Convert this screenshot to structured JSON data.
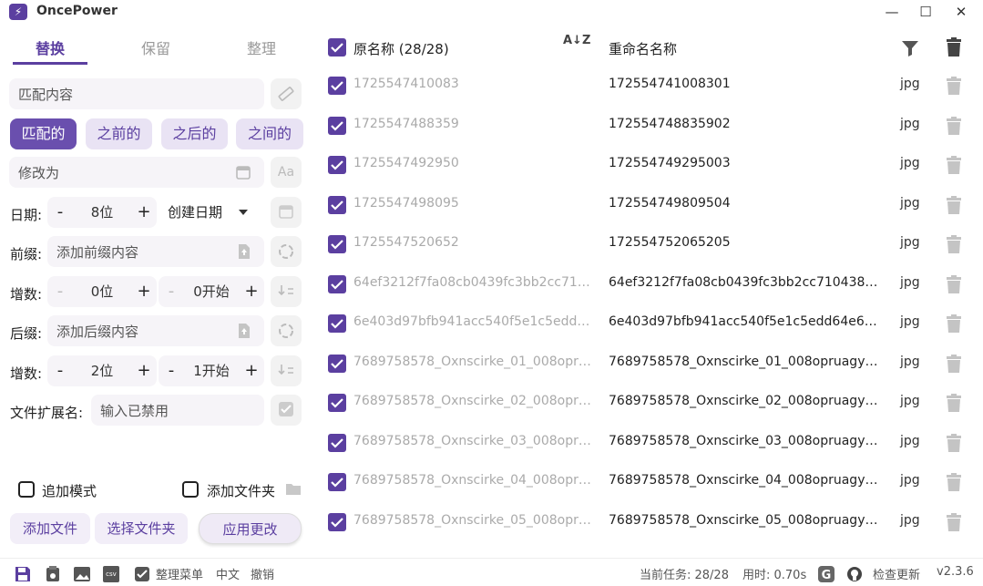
{
  "app": {
    "title": "OncePower",
    "logo_glyph": "⚡"
  },
  "window_controls": {
    "minimize": "—",
    "maximize": "☐",
    "close": "✕"
  },
  "tabs": [
    {
      "label": "替换",
      "active": true
    },
    {
      "label": "保留",
      "active": false
    },
    {
      "label": "整理",
      "active": false
    }
  ],
  "match": {
    "placeholder": "匹配内容"
  },
  "modes": [
    {
      "label": "匹配的",
      "active": true
    },
    {
      "label": "之前的",
      "active": false
    },
    {
      "label": "之后的",
      "active": false
    },
    {
      "label": "之间的",
      "active": false
    }
  ],
  "replace": {
    "placeholder": "修改为",
    "side_label": "Aa"
  },
  "date_row": {
    "label": "日期:",
    "minus": "-",
    "value": "8位",
    "plus": "+",
    "select": "创建日期"
  },
  "prefix_row": {
    "label": "前缀:",
    "placeholder": "添加前缀内容"
  },
  "inc1": {
    "label": "增数:",
    "digits": "0位",
    "start": "0开始",
    "minus": "-",
    "plus": "+"
  },
  "suffix_row": {
    "label": "后缀:",
    "placeholder": "添加后缀内容"
  },
  "inc2": {
    "label": "增数:",
    "digits": "2位",
    "start": "1开始",
    "minus": "-",
    "plus": "+"
  },
  "ext_row": {
    "label": "文件扩展名:",
    "placeholder": "输入已禁用"
  },
  "options": {
    "append_mode": "追加模式",
    "add_folder": "添加文件夹"
  },
  "buttons": {
    "add_files": "添加文件",
    "choose_folder": "选择文件夹",
    "apply": "应用更改"
  },
  "list_header": {
    "original": "原名称 (28/28)",
    "sort_icon": "A↓Z",
    "renamed": "重命名名称"
  },
  "rows": [
    {
      "original": "1725547410083",
      "renamed": "172554741008301",
      "ext": "jpg"
    },
    {
      "original": "1725547488359",
      "renamed": "172554748835902",
      "ext": "jpg"
    },
    {
      "original": "1725547492950",
      "renamed": "172554749295003",
      "ext": "jpg"
    },
    {
      "original": "1725547498095",
      "renamed": "172554749809504",
      "ext": "jpg"
    },
    {
      "original": "1725547520652",
      "renamed": "172554752065205",
      "ext": "jpg"
    },
    {
      "original": "64ef3212f7fa08cb0439fc3bb2cc710...",
      "renamed": "64ef3212f7fa08cb0439fc3bb2cc7104388...",
      "ext": "jpg"
    },
    {
      "original": "6e403d97bfb941acc540f5e1c5edd6...",
      "renamed": "6e403d97bfb941acc540f5e1c5edd64e66...",
      "ext": "jpg"
    },
    {
      "original": "7689758578_Oxnscirke_01_008opru...",
      "renamed": "7689758578_Oxnscirke_01_008opruagy1...",
      "ext": "jpg"
    },
    {
      "original": "7689758578_Oxnscirke_02_008opru...",
      "renamed": "7689758578_Oxnscirke_02_008opruagy1...",
      "ext": "jpg"
    },
    {
      "original": "7689758578_Oxnscirke_03_008opru...",
      "renamed": "7689758578_Oxnscirke_03_008opruagy1...",
      "ext": "jpg"
    },
    {
      "original": "7689758578_Oxnscirke_04_008opru...",
      "renamed": "7689758578_Oxnscirke_04_008opruagy1...",
      "ext": "jpg"
    },
    {
      "original": "7689758578_Oxnscirke_05_008opru...",
      "renamed": "7689758578_Oxnscirke_05_008opruagy1...",
      "ext": "jpg"
    }
  ],
  "statusbar": {
    "csv_label": "csv",
    "menu": "整理菜单",
    "lang": "中文",
    "undo": "撤销",
    "tasks": "当前任务: 28/28",
    "time": "用时: 0.70s",
    "check_update": "检查更新",
    "version": "v2.3.6"
  },
  "colors": {
    "accent": "#5b3fa0",
    "accent_light": "#e9e3f4",
    "field_bg": "#f6f4f8"
  }
}
